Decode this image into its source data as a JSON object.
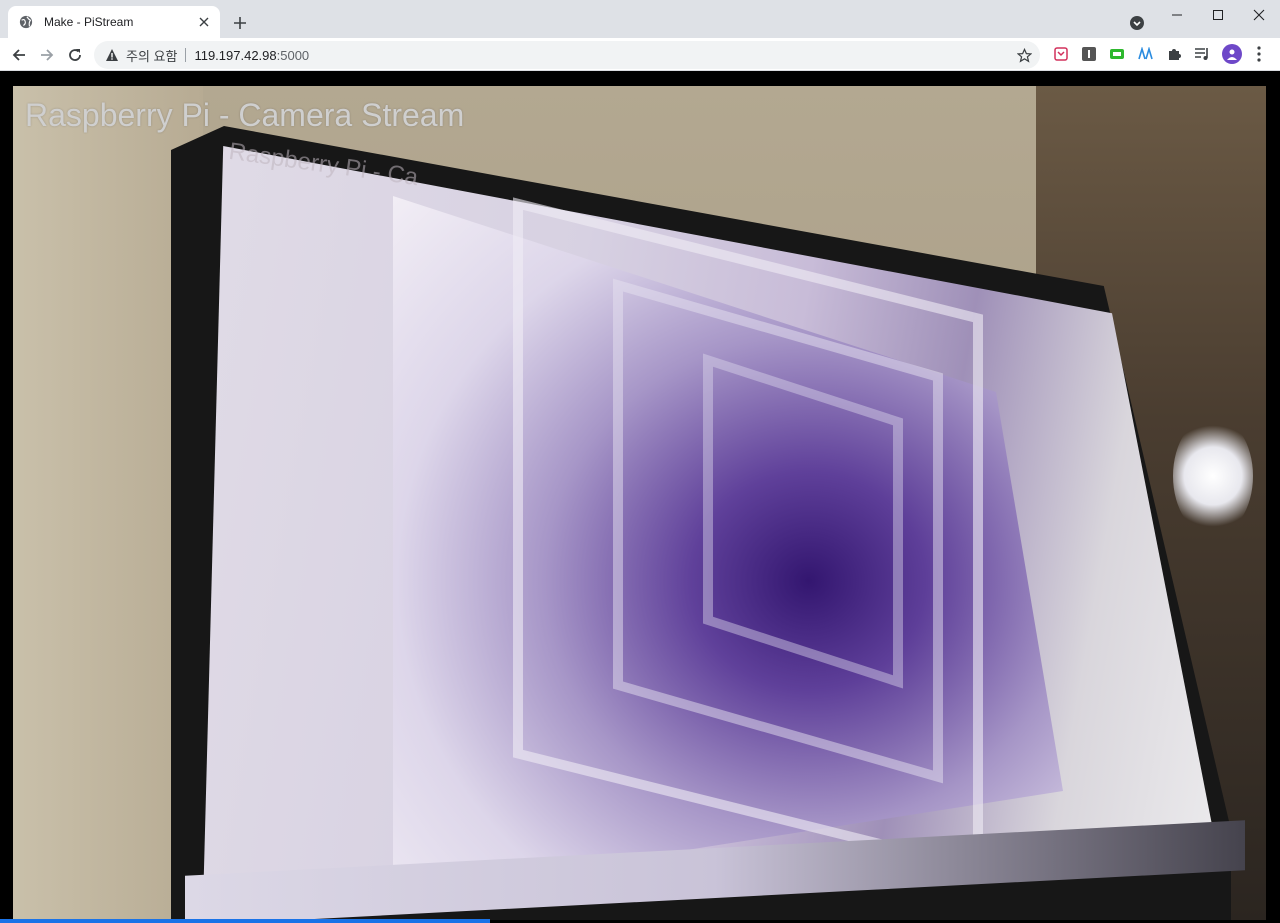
{
  "browser": {
    "tab": {
      "title": "Make - PiStream"
    },
    "address_bar": {
      "security_text": "주의 요함",
      "url_host": "119.197.42.98",
      "url_port": ":5000"
    },
    "icons": {
      "favicon": "globe-icon",
      "tab_close": "close-icon",
      "new_tab": "plus-icon",
      "tab_search": "chevron-down-circle-icon",
      "minimize": "minimize-icon",
      "maximize": "maximize-icon",
      "close_window": "close-icon",
      "back": "arrow-left-icon",
      "forward": "arrow-right-icon",
      "reload": "reload-icon",
      "security": "warning-icon",
      "bookmark": "star-icon",
      "extensions": [
        "pocket-icon",
        "instapaper-icon",
        "green-extension-icon",
        "blue-extension-icon",
        "puzzle-icon",
        "reading-list-icon"
      ],
      "profile": "profile-avatar-icon",
      "menu": "kebab-menu-icon"
    },
    "colors": {
      "tabstrip_bg": "#dee1e6",
      "toolbar_bg": "#ffffff",
      "accent": "#1a73e8"
    }
  },
  "page": {
    "title_overlay": "Raspberry Pi - Camera Stream",
    "inner_title_reflection": "Raspberry Pi - Ca"
  }
}
